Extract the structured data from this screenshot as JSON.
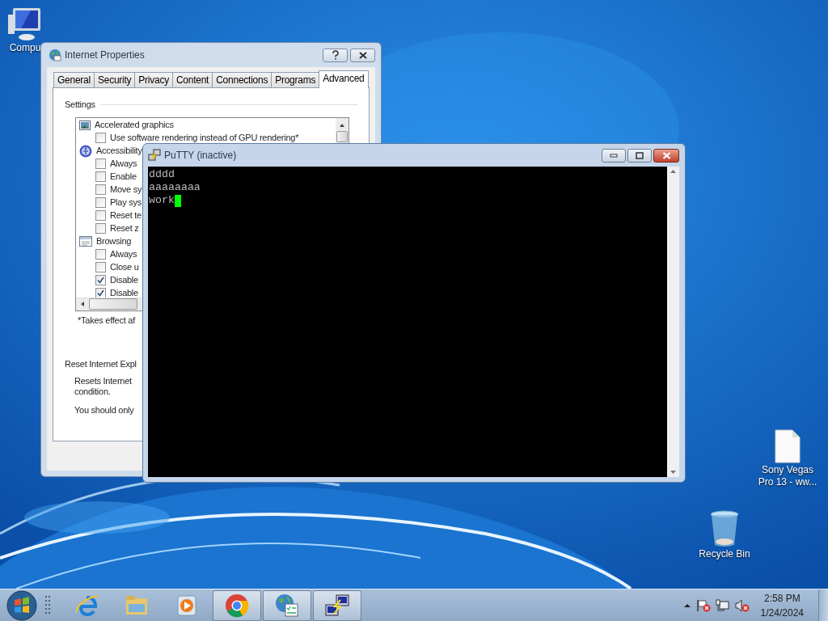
{
  "desktop_icons": [
    {
      "kind": "computer",
      "label": "Compu"
    },
    {
      "kind": "file",
      "label": "Sony Vegas Pro 13 - ww..."
    },
    {
      "kind": "recycle",
      "label": "Recycle Bin"
    }
  ],
  "internet_properties": {
    "title": "Internet Properties",
    "tabs": [
      {
        "label": "General",
        "selected": false
      },
      {
        "label": "Security",
        "selected": false
      },
      {
        "label": "Privacy",
        "selected": false
      },
      {
        "label": "Content",
        "selected": false
      },
      {
        "label": "Connections",
        "selected": false
      },
      {
        "label": "Programs",
        "selected": false
      },
      {
        "label": "Advanced",
        "selected": true
      }
    ],
    "group_label": "Settings",
    "settings": [
      {
        "kind": "graphics",
        "label": "Accelerated graphics"
      },
      {
        "kind": "checkbox",
        "label": "Use software rendering instead of GPU rendering*",
        "checked": false
      },
      {
        "kind": "accessibility",
        "label": "Accessibility"
      },
      {
        "kind": "checkbox",
        "label": "Always",
        "checked": false
      },
      {
        "kind": "checkbox",
        "label": "Enable",
        "checked": false
      },
      {
        "kind": "checkbox",
        "label": "Move sy",
        "checked": false
      },
      {
        "kind": "checkbox",
        "label": "Play sys",
        "checked": false
      },
      {
        "kind": "checkbox",
        "label": "Reset te",
        "checked": false
      },
      {
        "kind": "checkbox",
        "label": "Reset z",
        "checked": false
      },
      {
        "kind": "browsing",
        "label": "Browsing"
      },
      {
        "kind": "checkbox",
        "label": "Always",
        "checked": false
      },
      {
        "kind": "checkbox",
        "label": "Close u",
        "checked": false
      },
      {
        "kind": "checkbox",
        "label": "Disable",
        "checked": true
      },
      {
        "kind": "checkbox",
        "label": "Disable",
        "checked": true
      }
    ],
    "note": "*Takes effect af",
    "reset_heading": "Reset Internet Expl",
    "reset_lines": [
      "Resets Internet",
      "condition."
    ],
    "reset_note": "You should only"
  },
  "putty": {
    "title": "PuTTY (inactive)",
    "lines": [
      "dddd",
      "aaaaaaaa",
      "work"
    ]
  },
  "taskbar": {
    "apps": [
      {
        "kind": "ie",
        "open": false
      },
      {
        "kind": "explorer",
        "open": false
      },
      {
        "kind": "player",
        "open": false
      },
      {
        "kind": "chrome",
        "open": true
      },
      {
        "kind": "inetcpl",
        "open": true
      },
      {
        "kind": "putty",
        "open": true
      }
    ],
    "clock_time": "2:58 PM",
    "clock_date": "1/24/2024"
  }
}
